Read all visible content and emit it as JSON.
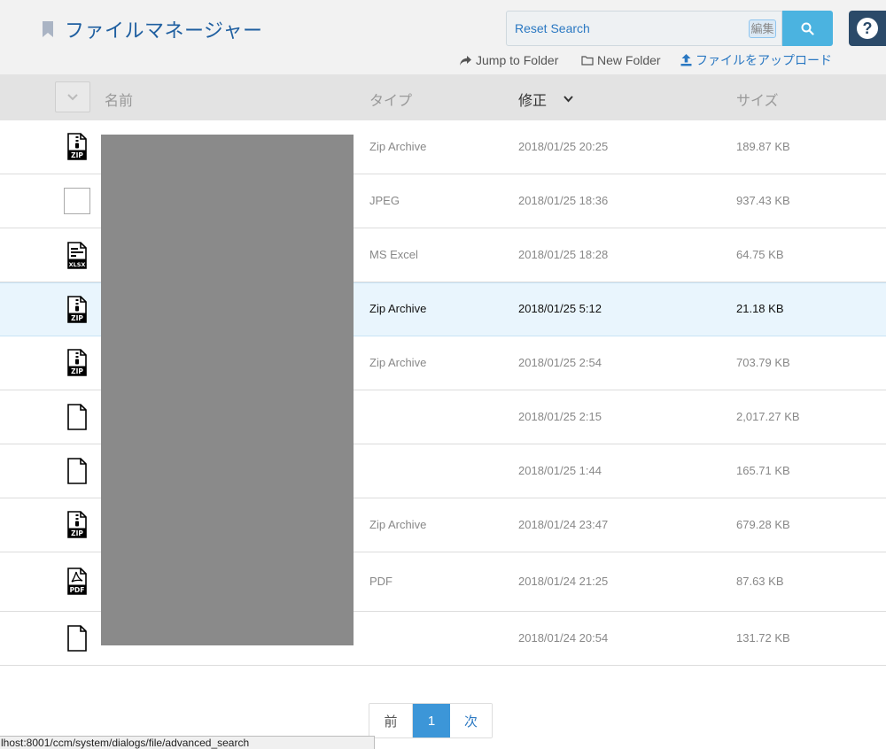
{
  "header": {
    "title": "ファイルマネージャー",
    "search_value": "Reset Search",
    "edit_badge": "編集",
    "help_label": "?",
    "actions": {
      "jump_to_folder": "Jump to Folder",
      "new_folder": "New Folder",
      "upload": "ファイルをアップロード"
    }
  },
  "table": {
    "columns": {
      "name": "名前",
      "type": "タイプ",
      "modified": "修正",
      "size": "サイズ"
    },
    "sort_column": "modified",
    "rows": [
      {
        "icon": "zip",
        "type": "Zip Archive",
        "modified": "2018/01/25 20:25",
        "size": "189.87 KB"
      },
      {
        "icon": "image",
        "type": "JPEG",
        "modified": "2018/01/25 18:36",
        "size": "937.43 KB"
      },
      {
        "icon": "xlsx",
        "type": "MS Excel",
        "modified": "2018/01/25 18:28",
        "size": "64.75 KB"
      },
      {
        "icon": "zip",
        "type": "Zip Archive",
        "modified": "2018/01/25 5:12",
        "size": "21.18 KB",
        "selected": true
      },
      {
        "icon": "zip",
        "type": "Zip Archive",
        "modified": "2018/01/25 2:54",
        "size": "703.79 KB"
      },
      {
        "icon": "file",
        "type": "",
        "modified": "2018/01/25 2:15",
        "size": "2,017.27 KB"
      },
      {
        "icon": "file",
        "type": "",
        "modified": "2018/01/25 1:44",
        "size": "165.71 KB"
      },
      {
        "icon": "zip",
        "type": "Zip Archive",
        "modified": "2018/01/24 23:47",
        "size": "679.28 KB"
      },
      {
        "icon": "pdf",
        "type": "PDF",
        "modified": "2018/01/24 21:25",
        "size": "87.63 KB"
      },
      {
        "icon": "file",
        "type": "",
        "modified": "2018/01/24 20:54",
        "size": "131.72 KB"
      }
    ]
  },
  "pagination": {
    "prev": "前",
    "current": "1",
    "next": "次"
  },
  "status_bar": {
    "url": "lhost:8001/ccm/system/dialogs/file/advanced_search"
  },
  "colors": {
    "title": "#1f5fa0",
    "link": "#2a78c2",
    "search_button": "#4bb3e0",
    "help_button": "#2b4a69",
    "pager_active": "#3c96d8",
    "selected_row": "#e9f5fd"
  }
}
